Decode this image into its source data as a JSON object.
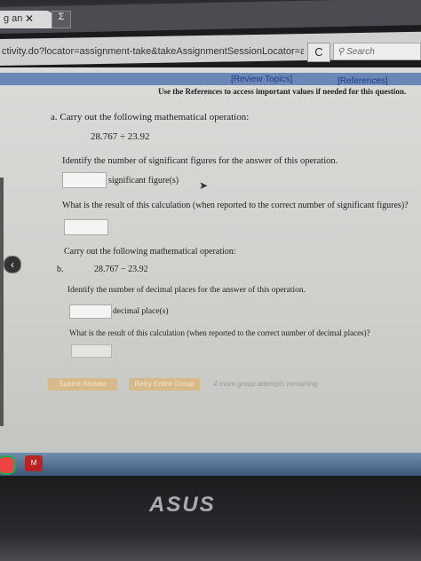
{
  "browser": {
    "tab_label": "g an",
    "tab_close": "✕",
    "tab2_label": "Σ",
    "url": "ctivity.do?locator=assignment-take&takeAssignmentSessionLocator=assignment-",
    "reload_glyph": "C",
    "search_placeholder": "Search"
  },
  "header": {
    "review_topics": "[Review Topics]",
    "references": "[References]",
    "note": "Use the References to access important values if needed for this question."
  },
  "part_a": {
    "title": "a. Carry out the following mathematical operation:",
    "expression": "28.767 ÷ 23.92",
    "q1": "Identify the number of significant figures for the answer of this operation.",
    "unit1": "significant figure(s)",
    "q2": "What is the result of this calculation (when reported to the correct number of significant figures)?"
  },
  "part_b": {
    "title": "Carry out the following mathematical operation:",
    "label": "b.",
    "expression": "28.767 − 23.92",
    "q1": "Identify the number of decimal places for the answer of this operation.",
    "unit1": "decimal place(s)",
    "q2": "What is the result of this calculation (when reported to the correct number of decimal places)?"
  },
  "actions": {
    "submit": "Submit Answer",
    "retry": "Retry Entire Group",
    "remaining": "4 more group attempts remaining"
  },
  "taskbar": {
    "mcafee": "M"
  },
  "laptop": {
    "brand": "ASUS"
  }
}
